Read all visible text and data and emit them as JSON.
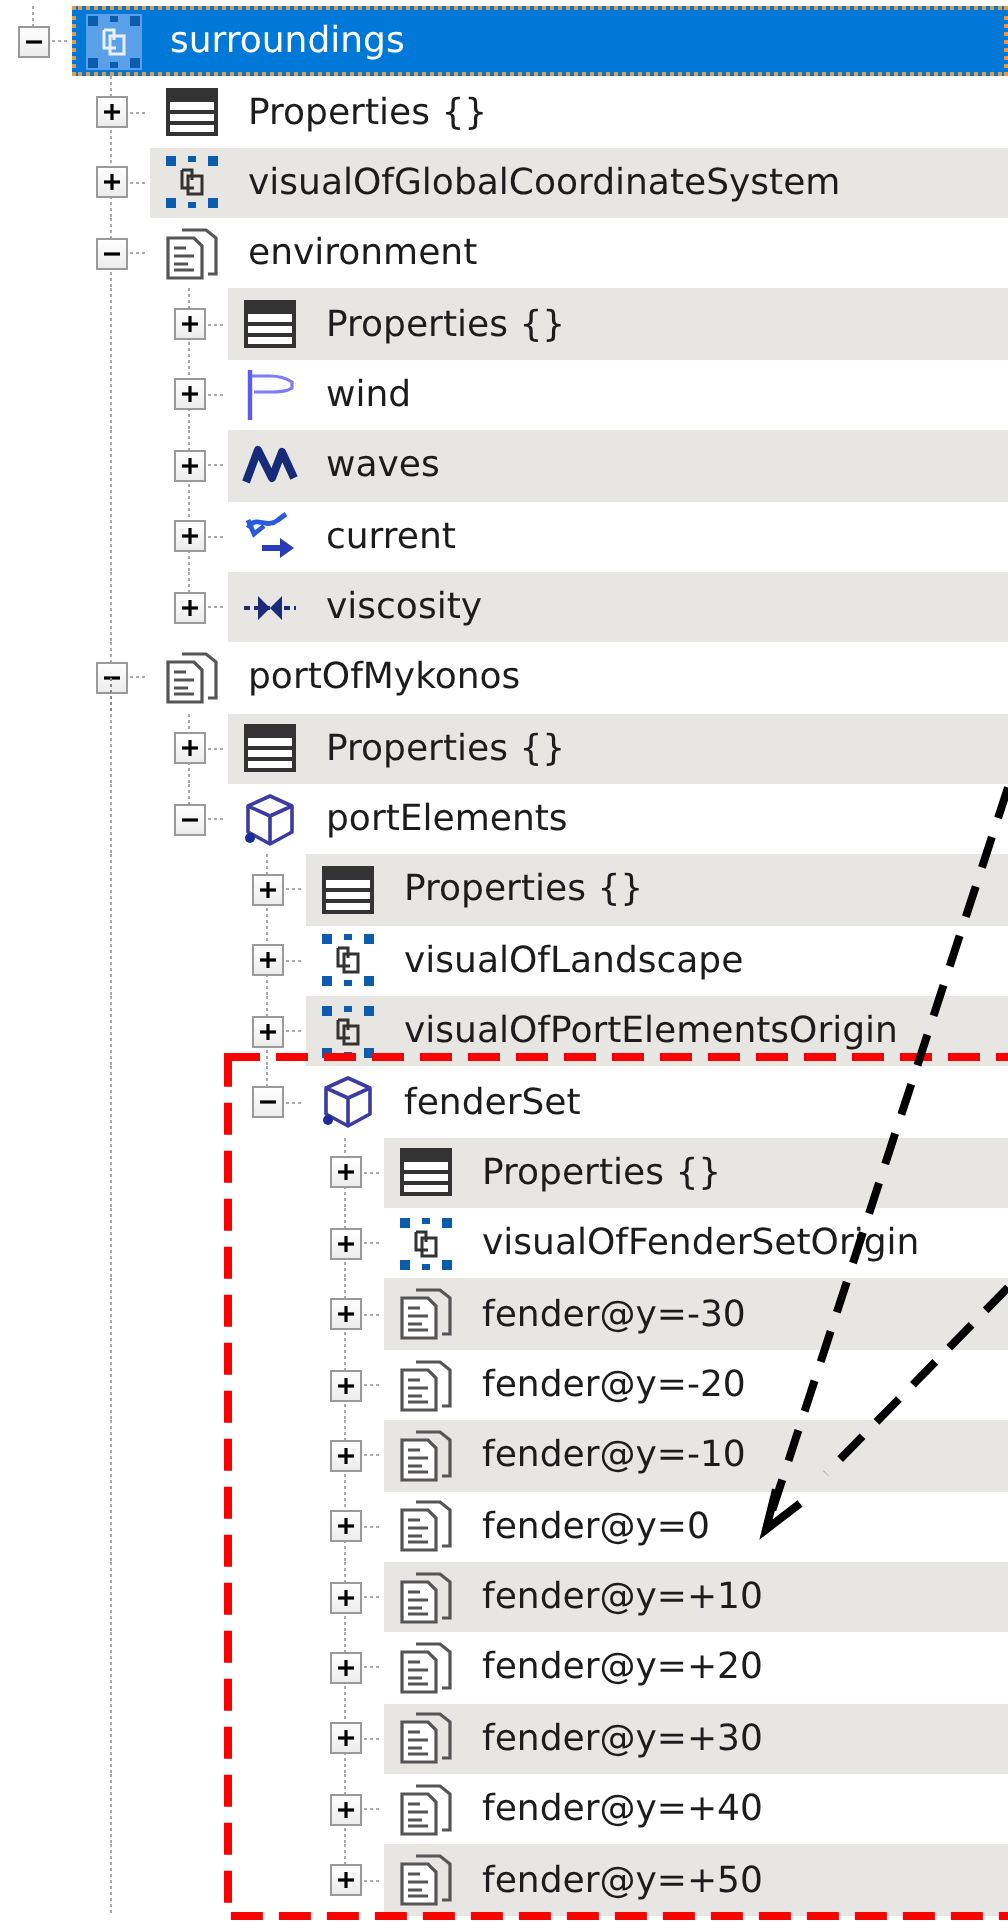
{
  "tree": [
    {
      "name": "surroundings",
      "kind": "frame",
      "expanded": true,
      "selected": true,
      "children": [
        {
          "name": "Properties {}",
          "kind": "table",
          "expanded": false,
          "selected": false
        },
        {
          "name": "visualOfGlobalCoordinateSystem",
          "kind": "frame",
          "expanded": false,
          "selected": false
        },
        {
          "name": "environment",
          "kind": "document",
          "expanded": true,
          "selected": false,
          "children": [
            {
              "name": "Properties {}",
              "kind": "table",
              "expanded": false,
              "selected": false
            },
            {
              "name": "wind",
              "kind": "flag",
              "expanded": false,
              "selected": false
            },
            {
              "name": "waves",
              "kind": "wave",
              "expanded": false,
              "selected": false
            },
            {
              "name": "current",
              "kind": "current",
              "expanded": false,
              "selected": false
            },
            {
              "name": "viscosity",
              "kind": "viscosity",
              "expanded": false,
              "selected": false
            }
          ]
        },
        {
          "name": "portOfMykonos",
          "kind": "document",
          "expanded": true,
          "selected": false,
          "continues": true,
          "children": [
            {
              "name": "Properties {}",
              "kind": "table",
              "expanded": false,
              "selected": false
            },
            {
              "name": "portElements",
              "kind": "cube",
              "expanded": true,
              "selected": false,
              "children": [
                {
                  "name": "Properties {}",
                  "kind": "table",
                  "expanded": false,
                  "selected": false
                },
                {
                  "name": "visualOfLandscape",
                  "kind": "frame",
                  "expanded": false,
                  "selected": false
                },
                {
                  "name": "visualOfPortElementsOrigin",
                  "kind": "frame",
                  "expanded": false,
                  "selected": false
                },
                {
                  "name": "fenderSet",
                  "kind": "cube",
                  "expanded": true,
                  "selected": false,
                  "framed": true,
                  "children": [
                    {
                      "name": "Properties {}",
                      "kind": "table",
                      "expanded": false,
                      "selected": false
                    },
                    {
                      "name": "visualOfFenderSetOrigin",
                      "kind": "frame",
                      "expanded": false,
                      "selected": false
                    },
                    {
                      "name": "fender@y=-30",
                      "kind": "document",
                      "expanded": false,
                      "selected": false
                    },
                    {
                      "name": "fender@y=-20",
                      "kind": "document",
                      "expanded": false,
                      "selected": false
                    },
                    {
                      "name": "fender@y=-10",
                      "kind": "document",
                      "expanded": false,
                      "selected": false
                    },
                    {
                      "name": "fender@y=0",
                      "kind": "document",
                      "expanded": false,
                      "selected": false,
                      "pointed": true
                    },
                    {
                      "name": "fender@y=+10",
                      "kind": "document",
                      "expanded": false,
                      "selected": false
                    },
                    {
                      "name": "fender@y=+20",
                      "kind": "document",
                      "expanded": false,
                      "selected": false
                    },
                    {
                      "name": "fender@y=+30",
                      "kind": "document",
                      "expanded": false,
                      "selected": false
                    },
                    {
                      "name": "fender@y=+40",
                      "kind": "document",
                      "expanded": false,
                      "selected": false
                    },
                    {
                      "name": "fender@y=+50",
                      "kind": "document",
                      "expanded": false,
                      "selected": false
                    }
                  ]
                }
              ]
            }
          ]
        }
      ]
    }
  ]
}
